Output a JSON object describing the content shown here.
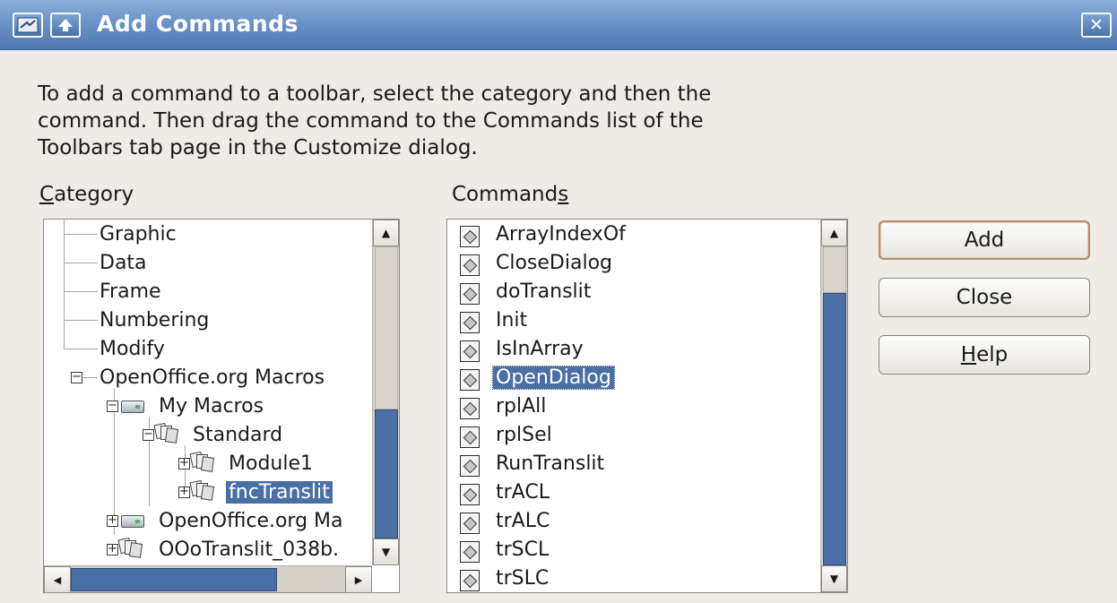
{
  "window": {
    "title": "Add Commands",
    "menu_icon": "window-menu-icon",
    "rollup_icon": "arrow-up-icon",
    "close_icon": "close-icon",
    "close_glyph": "✕"
  },
  "intro_text": "To add a command to a toolbar, select the category and then the\ncommand. Then drag the command to the Commands list of the\nToolbars tab page in the Customize dialog.",
  "category": {
    "label": "Category",
    "accel": "C",
    "label_rest": "ategory",
    "items": [
      {
        "label": "Graphic"
      },
      {
        "label": "Data"
      },
      {
        "label": "Frame"
      },
      {
        "label": "Numbering"
      },
      {
        "label": "Modify"
      },
      {
        "label": "OpenOffice.org Macros",
        "expander": "⊟"
      },
      {
        "label": "My Macros",
        "expander": "⊟",
        "icon": "drive-icon"
      },
      {
        "label": "Standard",
        "expander": "⊟",
        "icon": "library-icon"
      },
      {
        "label": "Module1",
        "expander": "⊞",
        "icon": "module-icon"
      },
      {
        "label": "fncTranslit",
        "expander": "⊞",
        "icon": "module-icon",
        "selected": true
      },
      {
        "label": "OpenOffice.org Ma",
        "expander": "⊞",
        "icon": "drive-icon"
      },
      {
        "label": "OOoTranslit_038b.",
        "expander": "⊞",
        "icon": "library-icon"
      }
    ]
  },
  "commands": {
    "label": "Commands",
    "label_main": "Command",
    "accel": "s",
    "items": [
      {
        "label": "ArrayIndexOf"
      },
      {
        "label": "CloseDialog"
      },
      {
        "label": "doTranslit"
      },
      {
        "label": "Init"
      },
      {
        "label": "IsInArray"
      },
      {
        "label": "OpenDialog",
        "selected": true
      },
      {
        "label": "rplAll"
      },
      {
        "label": "rplSel"
      },
      {
        "label": "RunTranslit"
      },
      {
        "label": "trACL"
      },
      {
        "label": "trALC"
      },
      {
        "label": "trSCL"
      },
      {
        "label": "trSLC"
      }
    ]
  },
  "buttons": {
    "add": "Add",
    "close": "Close",
    "help": "Help",
    "help_accel": "H",
    "help_rest": "elp"
  },
  "scrollbars": {
    "up_glyph": "▲",
    "down_glyph": "▼",
    "left_glyph": "◀",
    "right_glyph": "▶"
  },
  "colors": {
    "titlebar": "#6b93c7",
    "selection": "#4a6fa5",
    "dialog_bg": "#efebe7"
  }
}
